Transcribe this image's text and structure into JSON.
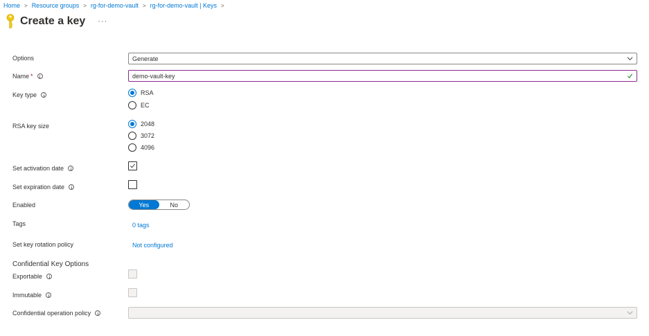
{
  "breadcrumb": [
    {
      "label": "Home"
    },
    {
      "label": "Resource groups"
    },
    {
      "label": "rg-for-demo-vault"
    },
    {
      "label": "rg-for-demo-vault | Keys"
    }
  ],
  "breadcrumb_separator": ">",
  "page": {
    "title": "Create a key",
    "more_label": "···"
  },
  "icons": {
    "page_icon": "key-icon",
    "page_icon_color": "#f2c811"
  },
  "form": {
    "options": {
      "label": "Options",
      "value": "Generate"
    },
    "name": {
      "label": "Name",
      "required_mark": "*",
      "value": "demo-vault-key",
      "valid": true
    },
    "key_type": {
      "label": "Key type",
      "options": [
        "RSA",
        "EC"
      ],
      "selected": "RSA"
    },
    "rsa_key_size": {
      "label": "RSA key size",
      "options": [
        "2048",
        "3072",
        "4096"
      ],
      "selected": "2048"
    },
    "activation_date": {
      "label": "Set activation date",
      "checked": true
    },
    "expiration_date": {
      "label": "Set expiration date",
      "checked": false
    },
    "enabled": {
      "label": "Enabled",
      "yes_label": "Yes",
      "no_label": "No",
      "value": "Yes"
    },
    "tags": {
      "label": "Tags",
      "link": "0 tags"
    },
    "rotation_policy": {
      "label": "Set key rotation policy",
      "link": "Not configured"
    },
    "confidential": {
      "heading": "Confidential Key Options",
      "exportable": {
        "label": "Exportable",
        "checked": false,
        "disabled": true
      },
      "immutable": {
        "label": "Immutable",
        "checked": false,
        "disabled": true
      },
      "operation_policy": {
        "label": "Confidential operation policy",
        "value": "",
        "disabled": true
      }
    }
  },
  "colors": {
    "accent": "#0078d4",
    "focus_border": "#8a2a8c",
    "valid_check": "#107c10"
  }
}
